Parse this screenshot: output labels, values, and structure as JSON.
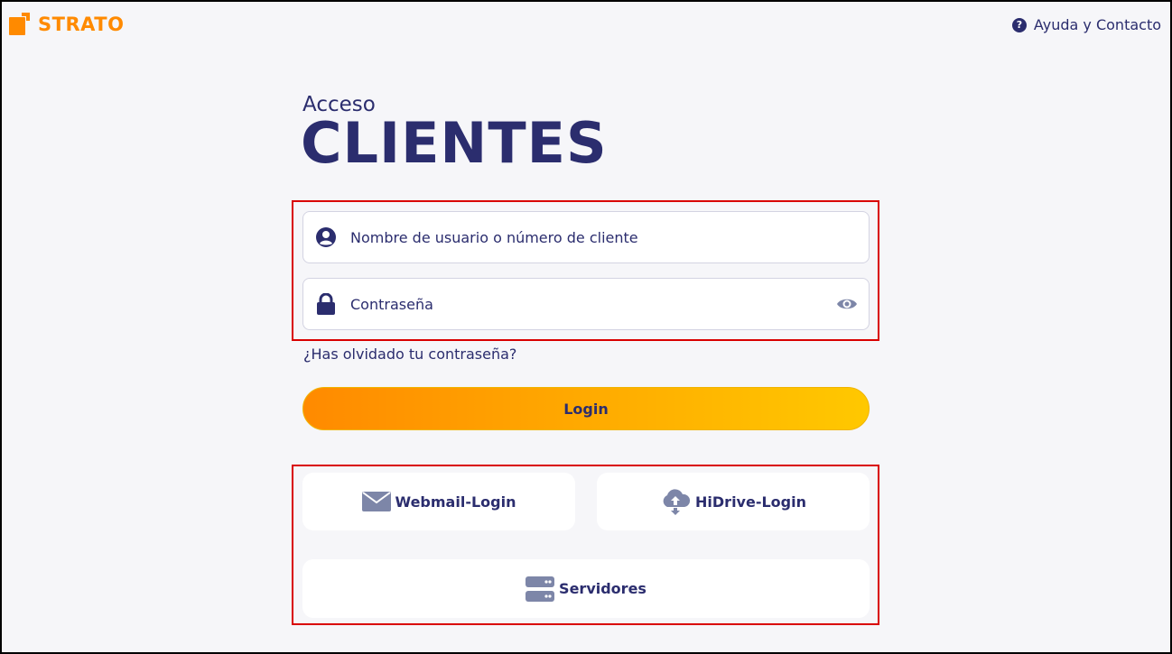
{
  "brand": {
    "name": "STRATO",
    "color": "#ff8a00"
  },
  "header": {
    "help_icon": "question-circle-icon",
    "help_label": "Ayuda y Contacto"
  },
  "hero": {
    "eyebrow": "Acceso",
    "title": "CLIENTES"
  },
  "form": {
    "username": {
      "icon": "user-circle-icon",
      "placeholder": "Nombre de usuario o número de cliente",
      "value": ""
    },
    "password": {
      "icon": "lock-icon",
      "placeholder": "Contraseña",
      "value": "",
      "toggle_icon": "eye-icon"
    },
    "forgot_label": "¿Has olvidado tu contraseña?",
    "login_label": "Login"
  },
  "quick_links": {
    "webmail": {
      "icon": "envelope-icon",
      "label": "Webmail-Login"
    },
    "hidrive": {
      "icon": "cloud-upload-icon",
      "label": "HiDrive-Login"
    },
    "servers": {
      "icon": "server-icon",
      "label": "Servidores"
    }
  },
  "colors": {
    "navy": "#2b2d6e",
    "accent": "#ff8a00",
    "highlight_border": "#d90000",
    "icon_gray": "#7d86a8",
    "background": "#f6f6f9"
  }
}
